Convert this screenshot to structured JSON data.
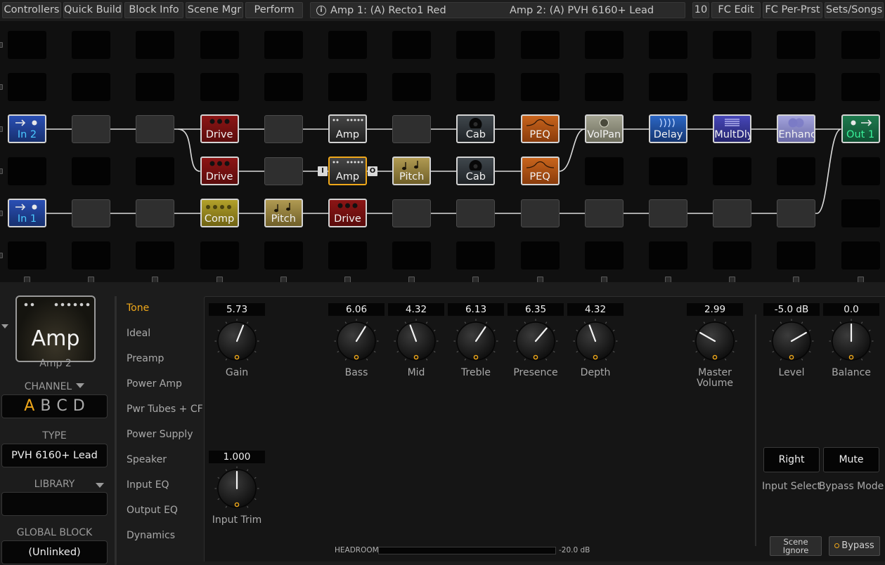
{
  "toolbar": {
    "controllers": "Controllers",
    "quick_build": "Quick Build",
    "block_info": "Block Info",
    "scene_mgr": "Scene Mgr",
    "perform": "Perform",
    "amp1": "Amp 1: (A) Recto1 Red",
    "amp2": "Amp 2: (A) PVH 6160+ Lead",
    "preset_num": "10",
    "fc_edit": "FC Edit",
    "fc_per_prst": "FC Per-Prst",
    "sets_songs": "Sets/Songs"
  },
  "grid": {
    "blocks": [
      {
        "label": "In 2",
        "type": "in"
      },
      {
        "label": "Drive",
        "type": "drive"
      },
      {
        "label": "Amp",
        "type": "amp"
      },
      {
        "label": "Cab",
        "type": "cab"
      },
      {
        "label": "PEQ",
        "type": "peq"
      },
      {
        "label": "VolPan",
        "type": "volpan"
      },
      {
        "label": "Delay",
        "type": "delay"
      },
      {
        "label": "MultDly",
        "type": "multdly"
      },
      {
        "label": "Enhance",
        "type": "enhance"
      },
      {
        "label": "Out 1",
        "type": "out"
      },
      {
        "label": "Drive",
        "type": "drive"
      },
      {
        "label": "Amp",
        "type": "amp"
      },
      {
        "label": "Pitch",
        "type": "pitch"
      },
      {
        "label": "Cab",
        "type": "cab"
      },
      {
        "label": "PEQ",
        "type": "peq"
      },
      {
        "label": "In 1",
        "type": "in"
      },
      {
        "label": "Comp",
        "type": "comp"
      },
      {
        "label": "Pitch",
        "type": "pitch"
      },
      {
        "label": "Drive",
        "type": "drive"
      }
    ],
    "amp_input_tag": "I",
    "amp_output_tag": "O"
  },
  "block_panel": {
    "name": "Amp",
    "instance": "Amp 2",
    "channel_title": "CHANNEL",
    "channels": [
      "A",
      "B",
      "C",
      "D"
    ],
    "active_channel": "A",
    "type_title": "TYPE",
    "type_value": "PVH 6160+ Lead",
    "library_title": "LIBRARY",
    "library_value": "",
    "global_title": "GLOBAL BLOCK",
    "global_value": "(Unlinked)"
  },
  "tabs": [
    "Tone",
    "Ideal",
    "Preamp",
    "Power Amp",
    "Pwr Tubes + CF",
    "Power Supply",
    "Speaker",
    "Input EQ",
    "Output EQ",
    "Dynamics"
  ],
  "active_tab": "Tone",
  "knobs": {
    "gain": {
      "label": "Gain",
      "value": "5.73",
      "level": 0.573
    },
    "bass": {
      "label": "Bass",
      "value": "6.06",
      "level": 0.606
    },
    "mid": {
      "label": "Mid",
      "value": "4.32",
      "level": 0.432
    },
    "treble": {
      "label": "Treble",
      "value": "6.13",
      "level": 0.613
    },
    "presence": {
      "label": "Presence",
      "value": "6.35",
      "level": 0.635
    },
    "depth": {
      "label": "Depth",
      "value": "4.32",
      "level": 0.432
    },
    "master": {
      "label": "Master Volume",
      "value": "2.99",
      "level": 0.299
    },
    "level": {
      "label": "Level",
      "value": "-5.0 dB",
      "level": 0.7
    },
    "balance": {
      "label": "Balance",
      "value": "0.0",
      "level": 0.5
    },
    "input_trim": {
      "label": "Input Trim",
      "value": "1.000",
      "level": 0.5
    }
  },
  "selectors": {
    "input_select": {
      "label": "Input Select",
      "value": "Right"
    },
    "bypass_mode": {
      "label": "Bypass Mode",
      "value": "Mute"
    }
  },
  "buttons": {
    "scene_ignore": "Scene Ignore",
    "bypass": "Bypass"
  },
  "headroom": {
    "label": "HEADROOM",
    "value": "-20.0 dB"
  },
  "colors": {
    "accent": "#f0a81a",
    "panel": "#1c1c1c",
    "grid_bg": "#101010"
  }
}
